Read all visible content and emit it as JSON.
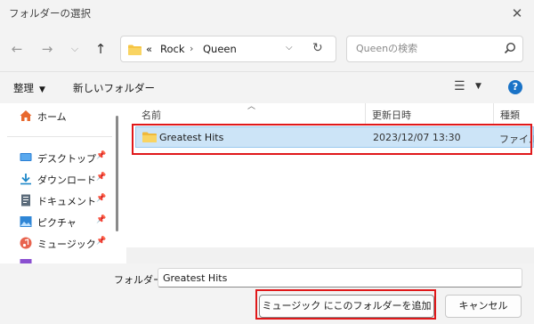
{
  "window": {
    "title": "フォルダーの選択"
  },
  "address": {
    "overflow": "«",
    "crumbs": [
      "Rock",
      "Queen"
    ]
  },
  "search": {
    "placeholder": "Queenの検索"
  },
  "toolbar": {
    "organize": "整理",
    "new_folder": "新しいフォルダー"
  },
  "sidebar": {
    "items": [
      {
        "label": "ホーム",
        "icon": "home-icon"
      },
      {
        "label": "デスクトップ",
        "icon": "desktop-icon",
        "pinned": true
      },
      {
        "label": "ダウンロード",
        "icon": "download-icon",
        "pinned": true
      },
      {
        "label": "ドキュメント",
        "icon": "documents-icon",
        "pinned": true
      },
      {
        "label": "ピクチャ",
        "icon": "pictures-icon",
        "pinned": true
      },
      {
        "label": "ミュージック",
        "icon": "music-icon",
        "pinned": true
      }
    ]
  },
  "columns": {
    "name": "名前",
    "date": "更新日時",
    "type": "種類"
  },
  "files": [
    {
      "name": "Greatest Hits",
      "date": "2023/12/07 13:30",
      "type": "ファイル"
    }
  ],
  "footer": {
    "folder_label": "フォルダー:",
    "folder_value": "Greatest Hits",
    "primary_button": "ミュージック にこのフォルダーを追加",
    "cancel_button": "キャンセル"
  },
  "colors": {
    "selection": "#cce4f7",
    "highlight": "#e0181a",
    "folder": "#f6c544",
    "accent": "#1a73c7"
  }
}
